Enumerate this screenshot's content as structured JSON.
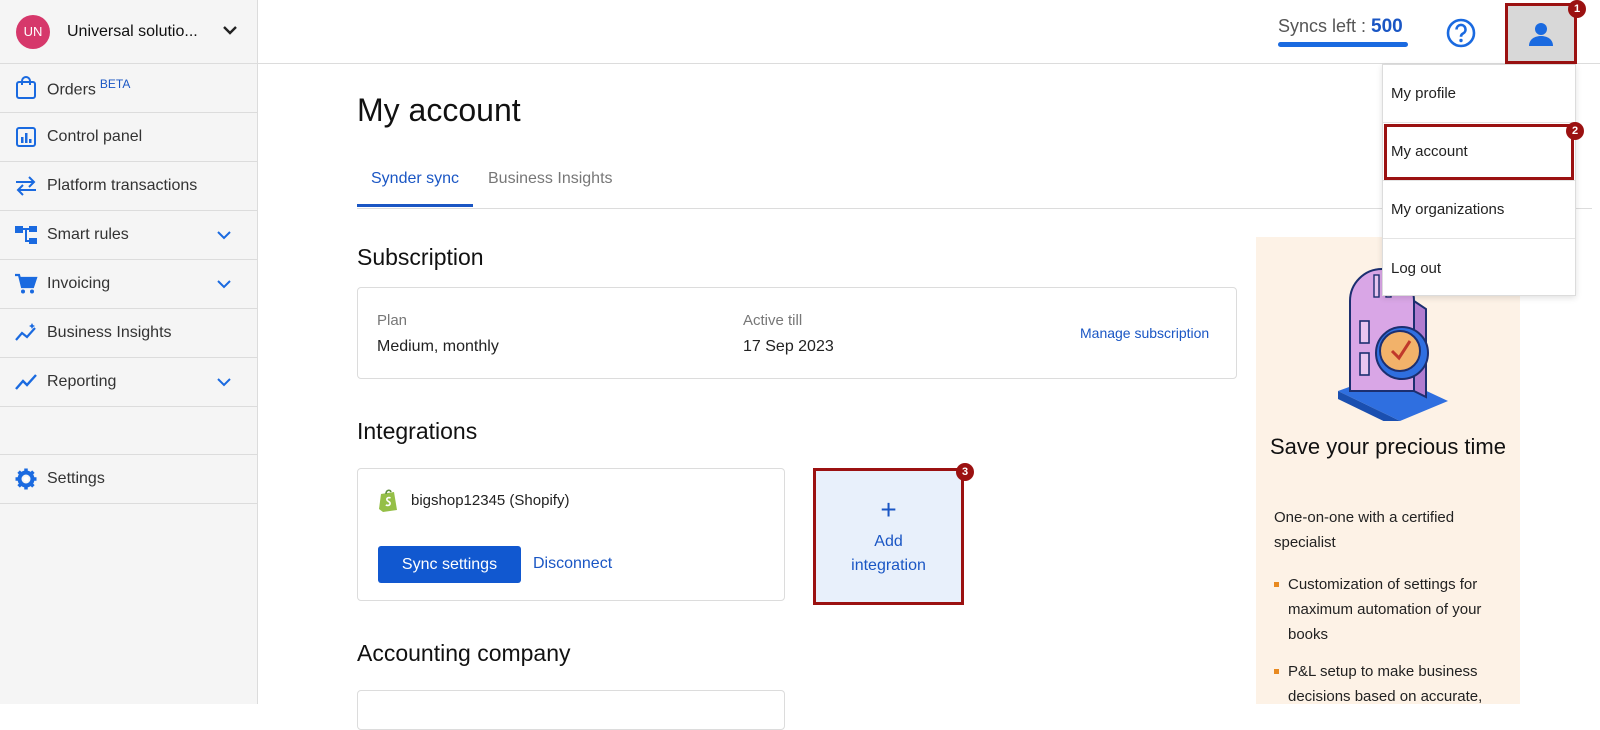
{
  "sidebar": {
    "org": {
      "initials": "UN",
      "name": "Universal solutio..."
    },
    "items": [
      {
        "label": "Orders",
        "badge": "BETA"
      },
      {
        "label": "Control panel"
      },
      {
        "label": "Platform transactions"
      },
      {
        "label": "Smart rules"
      },
      {
        "label": "Invoicing"
      },
      {
        "label": "Business Insights"
      },
      {
        "label": "Reporting"
      },
      {
        "label": "Settings"
      }
    ]
  },
  "topbar": {
    "syncs_label": "Syncs left :",
    "syncs_value": "500"
  },
  "user_menu": {
    "items": [
      "My profile",
      "My account",
      "My organizations",
      "Log out"
    ]
  },
  "markers": [
    "1",
    "2",
    "3"
  ],
  "page": {
    "title": "My account",
    "tabs": [
      "Synder sync",
      "Business Insights"
    ],
    "subscription": {
      "heading": "Subscription",
      "plan_label": "Plan",
      "plan_value": "Medium, monthly",
      "active_label": "Active till",
      "active_value": "17 Sep 2023",
      "manage_link": "Manage subscription"
    },
    "integrations": {
      "heading": "Integrations",
      "shop_name": "bigshop12345 (Shopify)",
      "sync_settings": "Sync settings",
      "disconnect": "Disconnect",
      "add_plus": "+",
      "add_label": "Add integration"
    },
    "accounting": {
      "heading": "Accounting company"
    }
  },
  "promo": {
    "title": "Save your precious time",
    "subtitle": "One-on-one with a certified specialist",
    "bullets": [
      "Customization of settings for maximum automation of your books",
      "P&L setup to make business decisions based on accurate,"
    ]
  },
  "colors": {
    "accent": "#1a56c4",
    "highlight": "#9b1111",
    "avatar": "#d6386b",
    "promo_bg": "#fdf2e6"
  }
}
